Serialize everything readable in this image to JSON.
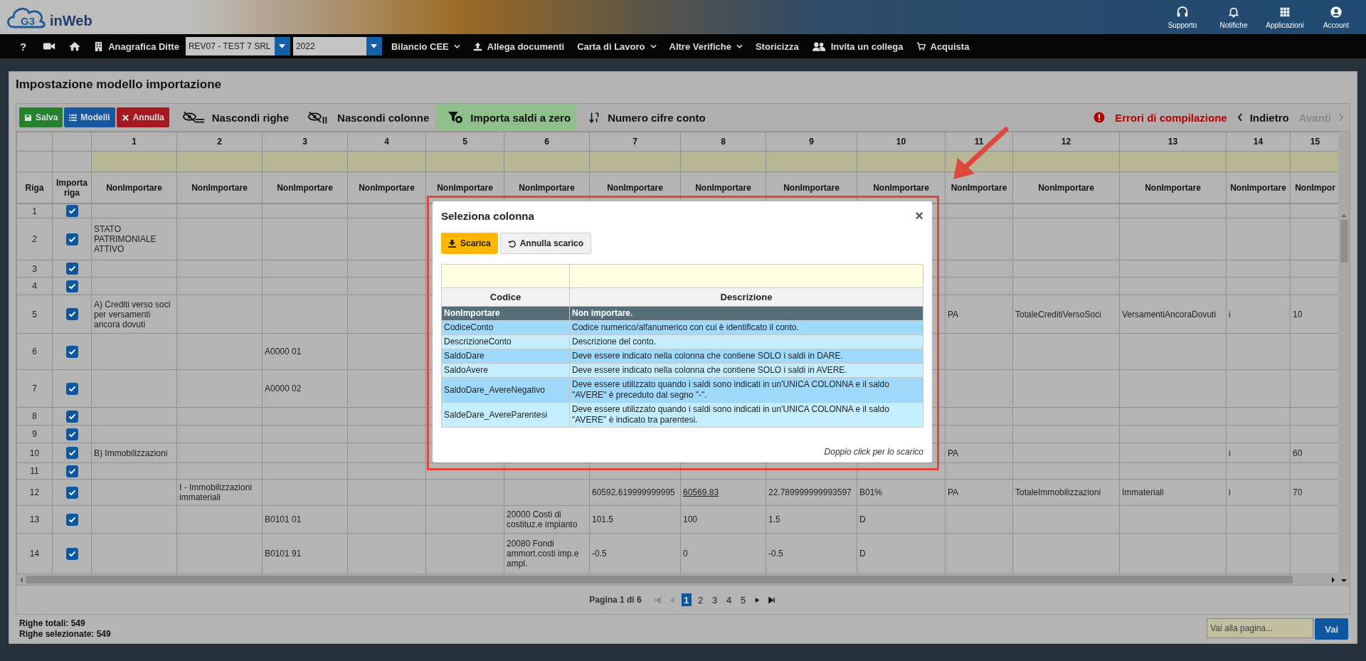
{
  "header": {
    "logo_mark": "G3",
    "app_name": "inWeb",
    "actions": [
      {
        "kind": "support",
        "label": "Supporto"
      },
      {
        "kind": "notifications",
        "label": "Notifiche"
      },
      {
        "kind": "apps",
        "label": "Applicazioni"
      },
      {
        "kind": "account",
        "label": "Account"
      }
    ]
  },
  "nav": [
    {
      "kind": "help",
      "label": "?"
    },
    {
      "kind": "video"
    },
    {
      "kind": "home"
    },
    {
      "kind": "company",
      "label": "Anagrafica Ditte"
    },
    {
      "kind": "select",
      "value": "REV07 - TEST 7 SRL"
    },
    {
      "kind": "select",
      "value": "2022"
    },
    {
      "kind": "menu",
      "label": "Bilancio CEE"
    },
    {
      "kind": "upload",
      "label": "Allega documenti"
    },
    {
      "kind": "menu",
      "label": "Carta di Lavoro"
    },
    {
      "kind": "menu",
      "label": "Altre Verifiche"
    },
    {
      "kind": "link",
      "label": "Storicizza"
    },
    {
      "kind": "invite",
      "label": "Invita un collega"
    },
    {
      "kind": "cart",
      "label": "Acquista"
    }
  ],
  "page": {
    "title": "Impostazione modello importazione"
  },
  "toolbar": {
    "buttons": [
      {
        "kind": "save",
        "label": "Salva"
      },
      {
        "kind": "list",
        "label": "Modelli"
      },
      {
        "kind": "cancel",
        "label": "Annulla"
      }
    ],
    "tools": [
      {
        "kind": "hide-rows",
        "label": "Nascondi righe",
        "selected": false
      },
      {
        "kind": "hide-columns",
        "label": "Nascondi colonne",
        "selected": false
      },
      {
        "kind": "filter",
        "label": "Importa saldi a zero",
        "selected": true
      },
      {
        "kind": "sort",
        "label": "Numero cifre conto",
        "selected": false
      }
    ],
    "errors": {
      "label": "Errori di compilazione"
    },
    "steps": [
      {
        "kind": "back",
        "label": "Indietro",
        "disabled": false
      },
      {
        "kind": "forward",
        "label": "Avanti",
        "disabled": true
      }
    ]
  },
  "table": {
    "row_header": "Riga",
    "import_header": "Importa riga",
    "columns": [
      {
        "number": "1",
        "mapping": "NonImportare"
      },
      {
        "number": "2",
        "mapping": "NonImportare"
      },
      {
        "number": "3",
        "mapping": "NonImportare"
      },
      {
        "number": "4",
        "mapping": "NonImportare"
      },
      {
        "number": "5",
        "mapping": "NonImportare"
      },
      {
        "number": "6",
        "mapping": "NonImportare"
      },
      {
        "number": "7",
        "mapping": "NonImportare"
      },
      {
        "number": "8",
        "mapping": "NonImportare"
      },
      {
        "number": "9",
        "mapping": "NonImportare"
      },
      {
        "number": "10",
        "mapping": "NonImportare"
      },
      {
        "number": "11",
        "mapping": "NonImportare"
      },
      {
        "number": "12",
        "mapping": "NonImportare"
      },
      {
        "number": "13",
        "mapping": "NonImportare"
      },
      {
        "number": "14",
        "mapping": "NonImportare"
      },
      {
        "number": "15",
        "mapping": "NonImpor"
      }
    ],
    "rows": [
      {
        "riga": "1",
        "import": true
      },
      {
        "riga": "2",
        "import": true,
        "cells": {
          "column_1": "STATO PATRIMONIALE ATTIVO"
        }
      },
      {
        "riga": "3",
        "import": true
      },
      {
        "riga": "4",
        "import": true
      },
      {
        "riga": "5",
        "import": true,
        "cells": {
          "column_1": "A) Crediti verso soci per versamenti ancora dovuti",
          "column_11": "PA",
          "column_12": "TotaleCreditiVersoSoci",
          "column_13": "VersamentiAncoraDovuti",
          "column_14": "i",
          "column_15": "10"
        }
      },
      {
        "riga": "6",
        "import": true,
        "cells": {
          "column_3": "A0000 01"
        }
      },
      {
        "riga": "7",
        "import": true,
        "cells": {
          "column_3": "A0000 02"
        }
      },
      {
        "riga": "8",
        "import": true
      },
      {
        "riga": "9",
        "import": true
      },
      {
        "riga": "10",
        "import": true,
        "cells": {
          "column_1": "B) Immobilizzazioni",
          "column_11": "PA",
          "column_14": "i",
          "column_15": "60"
        }
      },
      {
        "riga": "11",
        "import": true
      },
      {
        "riga": "12",
        "import": true,
        "cells": {
          "column_2": "I - Immobilizzazioni immateriali",
          "column_7": "60592.619999999995",
          "column_8": {
            "text": "60569.83",
            "link": true
          },
          "column_9": "22.789999999993597",
          "column_10": "B01%",
          "column_11": "PA",
          "column_12": "TotaleImmobilizzazioni",
          "column_13": "Immateriali",
          "column_14": "i",
          "column_15": "70"
        }
      },
      {
        "riga": "13",
        "import": true,
        "cells": {
          "column_3": "B0101 01",
          "column_6": "20000 Costi di costituz.e impianto",
          "column_7": "101.5",
          "column_8": "100",
          "column_9": "1.5",
          "column_10": "D"
        }
      },
      {
        "riga": "14",
        "import": true,
        "cells": {
          "column_3": "B0101 91",
          "column_6": "20080 Fondi ammort.costi imp.e ampl.",
          "column_7": "-0.5",
          "column_8": "0",
          "column_9": "-0.5",
          "column_10": "D"
        }
      }
    ]
  },
  "pager": {
    "label": "Pagina 1 di 6",
    "controls_before": [
      {
        "kind": "first",
        "disabled": true
      },
      {
        "kind": "previous",
        "disabled": true
      }
    ],
    "pages": [
      {
        "label": "1",
        "selected": true
      },
      {
        "label": "2",
        "selected": false
      },
      {
        "label": "3",
        "selected": false
      },
      {
        "label": "4",
        "selected": false
      },
      {
        "label": "5",
        "selected": false
      }
    ],
    "controls_after": [
      {
        "kind": "next",
        "disabled": false
      },
      {
        "kind": "last",
        "disabled": false
      }
    ]
  },
  "footer": {
    "totals": [
      "Righe totali: 549",
      "Righe selezionate: 549"
    ],
    "goto": {
      "placeholder": "Vai alla pagina...",
      "button": "Vai"
    }
  },
  "modal": {
    "title": "Seleziona colonna",
    "close": "×",
    "buttons": [
      {
        "kind": "download",
        "label": "Scarica"
      },
      {
        "kind": "undo",
        "label": "Annulla scarico"
      }
    ],
    "columns": [
      "Codice",
      "Descrizione"
    ],
    "rows": [
      {
        "code": "NonImportare",
        "description": "Non importare.",
        "selected": true
      },
      {
        "code": "CodiceConto",
        "description": "Codice numerico/alfanumerico con cui è identificato il conto.",
        "selected": false
      },
      {
        "code": "DescrizioneConto",
        "description": "Descrizione del conto.",
        "selected": false
      },
      {
        "code": "SaldoDare",
        "description": "Deve essere indicato nella colonna che contiene SOLO i saldi in DARE.",
        "selected": false
      },
      {
        "code": "SaldoAvere",
        "description": "Deve essere indicato nella colonna che contiene SOLO i saldi in AVERE.",
        "selected": false
      },
      {
        "code": "SaldoDare_AvereNegativo",
        "description": "Deve essere utilizzato quando i saldi sono indicati in un'UNICA COLONNA e il saldo \"AVERE\" è preceduto dal segno \"-\".",
        "selected": false
      },
      {
        "code": "SaldeDare_AvereParentesi",
        "description": "Deve essere utilizzato quando i saldi sono indicati in un'UNICA COLONNA e il saldo \"AVERE\" è indicato tra parentesi.",
        "selected": false
      }
    ],
    "hint": "Doppio click per lo scarico"
  }
}
